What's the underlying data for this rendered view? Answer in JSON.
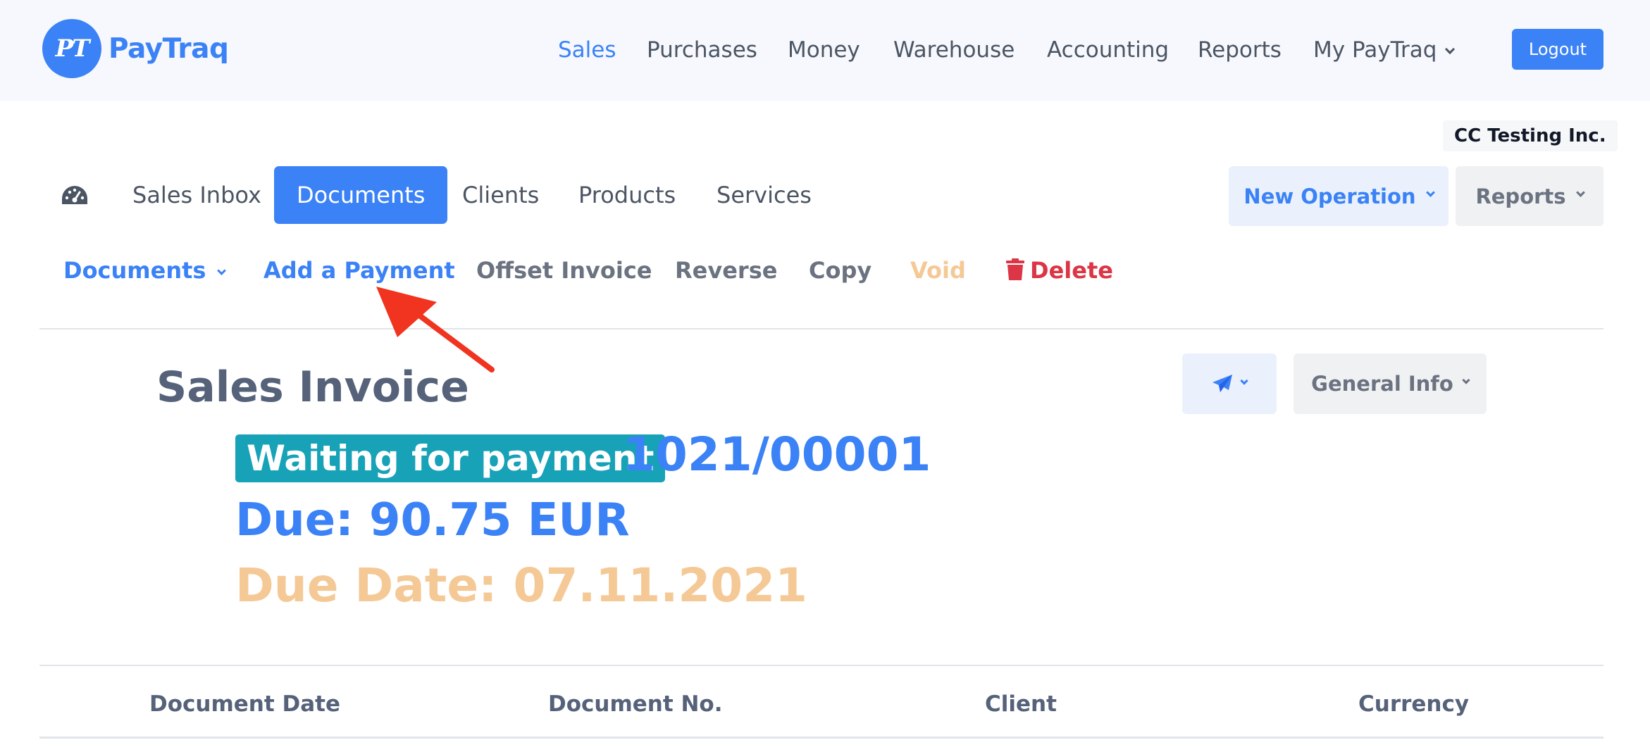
{
  "app": {
    "logo_initials": "PT",
    "logo_text": "PayTraq",
    "main_nav": [
      {
        "label": "Sales",
        "active": true
      },
      {
        "label": "Purchases",
        "active": false
      },
      {
        "label": "Money",
        "active": false
      },
      {
        "label": "Warehouse",
        "active": false
      },
      {
        "label": "Accounting",
        "active": false
      },
      {
        "label": "Reports",
        "active": false
      },
      {
        "label": "My PayTraq",
        "active": false,
        "dropdown": true
      }
    ],
    "logout_label": "Logout",
    "company_name": "CC Testing Inc."
  },
  "sub_nav": {
    "dashboard_icon": "dashboard-gauge-icon",
    "items": [
      {
        "label": "Sales Inbox",
        "active": false
      },
      {
        "label": "Documents",
        "active": true
      },
      {
        "label": "Clients",
        "active": false
      },
      {
        "label": "Products",
        "active": false
      },
      {
        "label": "Services",
        "active": false
      }
    ],
    "new_operation_label": "New Operation",
    "reports_label": "Reports"
  },
  "actions": {
    "documents_label": "Documents",
    "add_payment_label": "Add a Payment",
    "offset_invoice_label": "Offset Invoice",
    "reverse_label": "Reverse",
    "copy_label": "Copy",
    "void_label": "Void",
    "delete_label": "Delete"
  },
  "invoice": {
    "title": "Sales Invoice",
    "status_badge": "Waiting for payment",
    "document_number": "1021/00001",
    "due": "Due: 90.75 EUR",
    "due_date": "Due Date: 07.11.2021",
    "general_info_label": "General Info"
  },
  "table": {
    "headers": [
      "Document Date",
      "Document No.",
      "Client",
      "Currency"
    ]
  },
  "colors": {
    "primary": "#3b82f6",
    "badge": "#17a2b8",
    "void": "#f5c996",
    "delete": "#dc3545",
    "arrow": "#f0341f"
  }
}
